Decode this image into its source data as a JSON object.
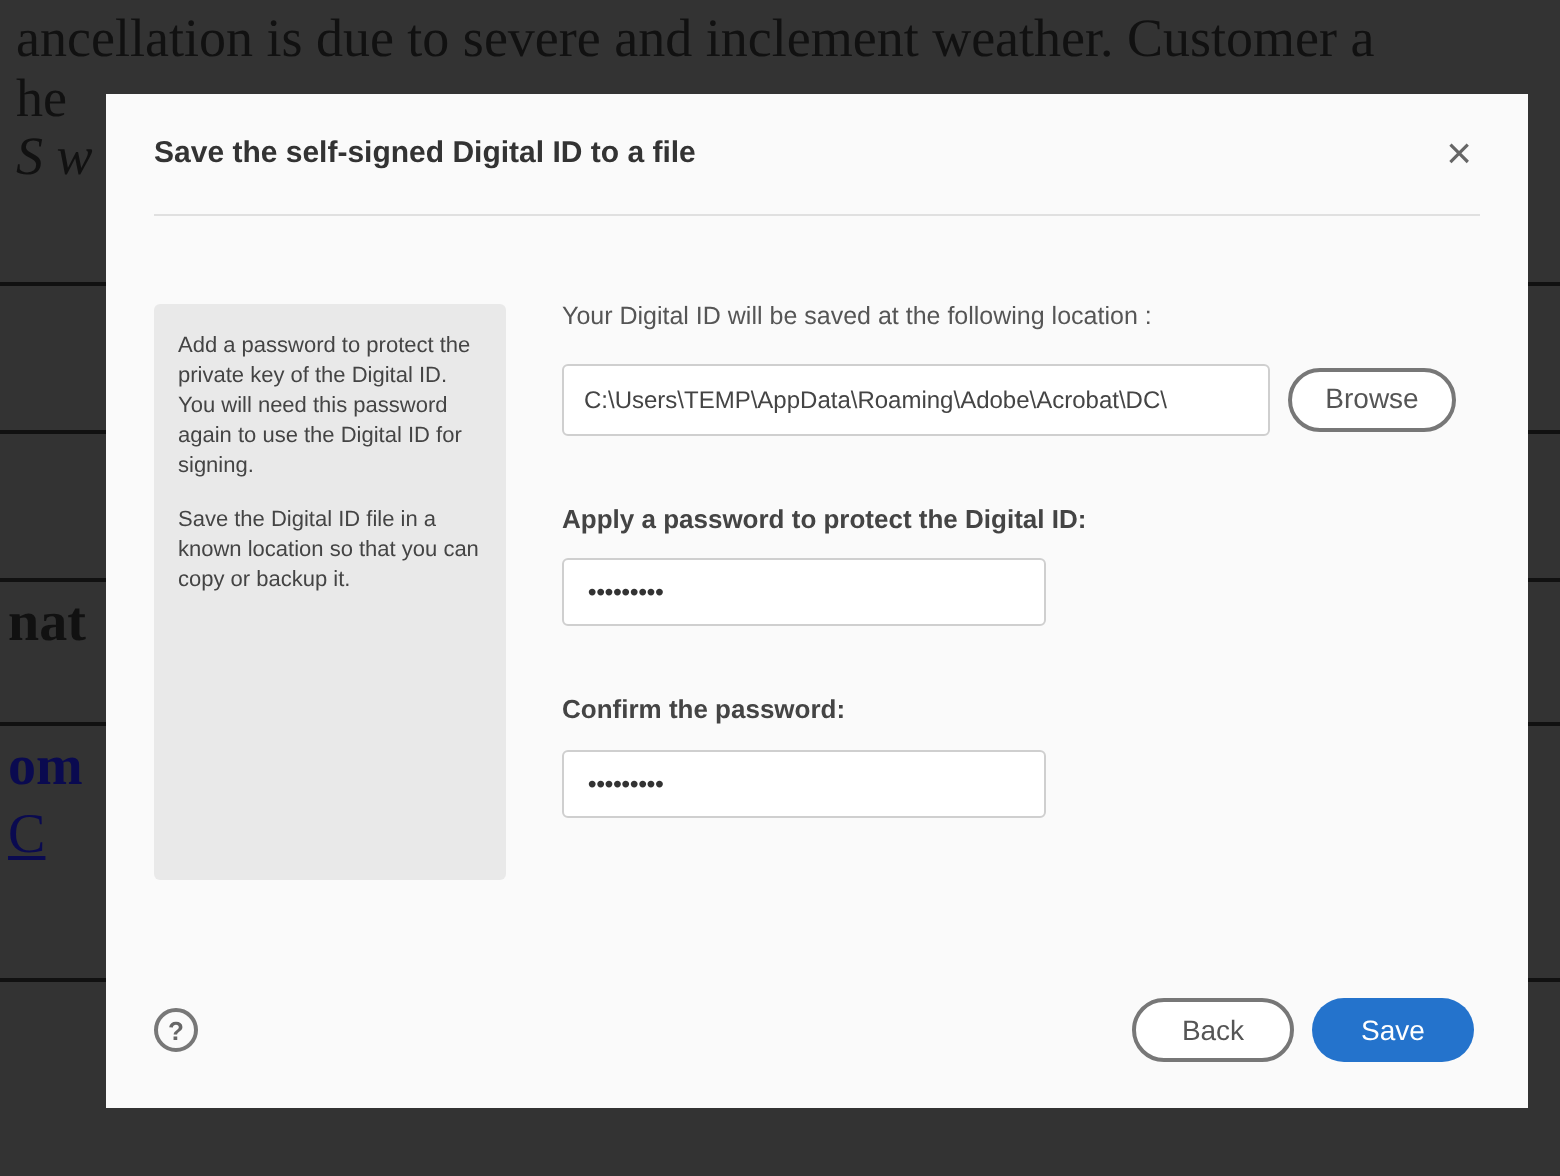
{
  "background_document": {
    "line_1": "ancellation is due to severe and inclement weather.  Customer a",
    "line_2_left": "he",
    "line_3_left": "S w",
    "fragment_bold": "nat",
    "fragment_link": "om",
    "fragment_underlined": "C"
  },
  "dialog": {
    "title": "Save the self-signed Digital ID to a file",
    "close": "×",
    "info_panel": [
      "Add a password to protect the private key of the Digital ID. You will need this password again to use the Digital ID for signing.",
      "Save the Digital ID file in a known location so that you can copy or backup it."
    ],
    "location_label": "Your Digital ID will be saved at the following location :",
    "location_value": "C:\\Users\\TEMP\\AppData\\Roaming\\Adobe\\Acrobat\\DC\\",
    "browse": "Browse",
    "password_label": "Apply a password to protect the Digital ID:",
    "password_value": "•••••••••",
    "confirm_label": "Confirm the password:",
    "confirm_value": "•••••••••",
    "help": "?",
    "buttons": [
      {
        "label": "Back",
        "kind": "secondary"
      },
      {
        "label": "Save",
        "kind": "primary"
      }
    ]
  }
}
